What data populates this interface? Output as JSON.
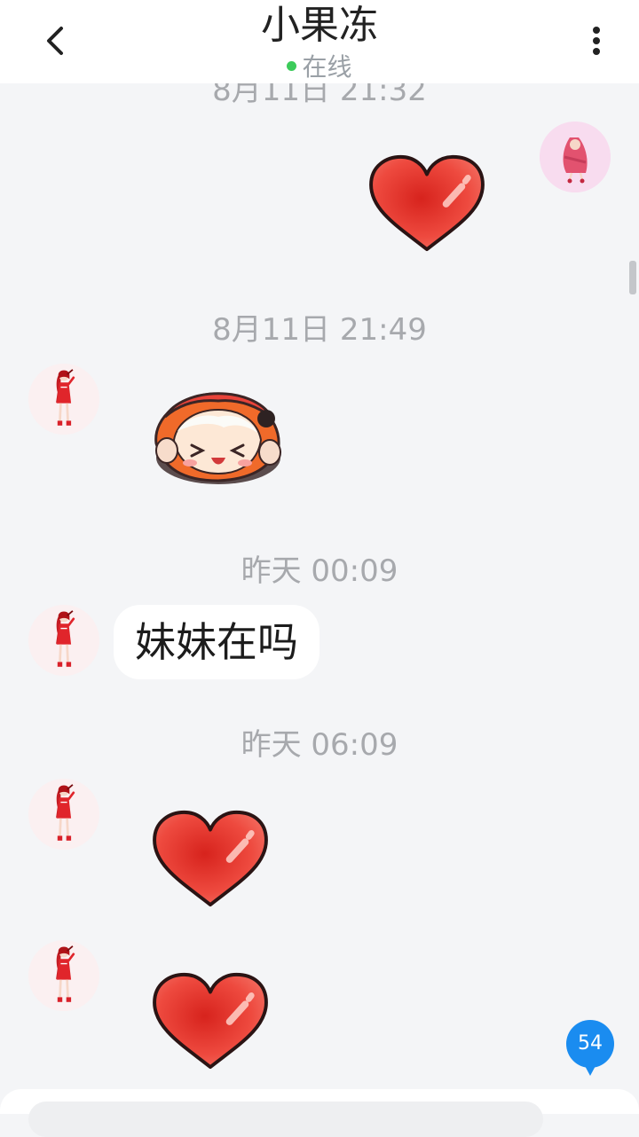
{
  "header": {
    "title": "小果冻",
    "status": "在线",
    "back_icon": "chevron-left-icon",
    "more_icon": "more-vertical-icon"
  },
  "messages": [
    {
      "timestamp": "8月11日 21:32",
      "sender": "self",
      "type": "sticker",
      "sticker": "red-heart"
    },
    {
      "timestamp": "8月11日 21:49",
      "sender": "contact",
      "type": "sticker",
      "sticker": "chibi-girl-hiding"
    },
    {
      "timestamp": "昨天 00:09",
      "sender": "contact",
      "type": "text",
      "text": "妹妹在吗"
    },
    {
      "timestamp": "昨天 06:09",
      "sender": "contact",
      "type": "sticker",
      "sticker": "red-heart"
    },
    {
      "sender": "contact",
      "type": "sticker",
      "sticker": "red-heart"
    }
  ],
  "unread_badge": "54",
  "colors": {
    "background": "#f4f5f7",
    "online_dot": "#3ccb5a",
    "badge": "#1a8cf0",
    "heart": "#e8362c"
  }
}
